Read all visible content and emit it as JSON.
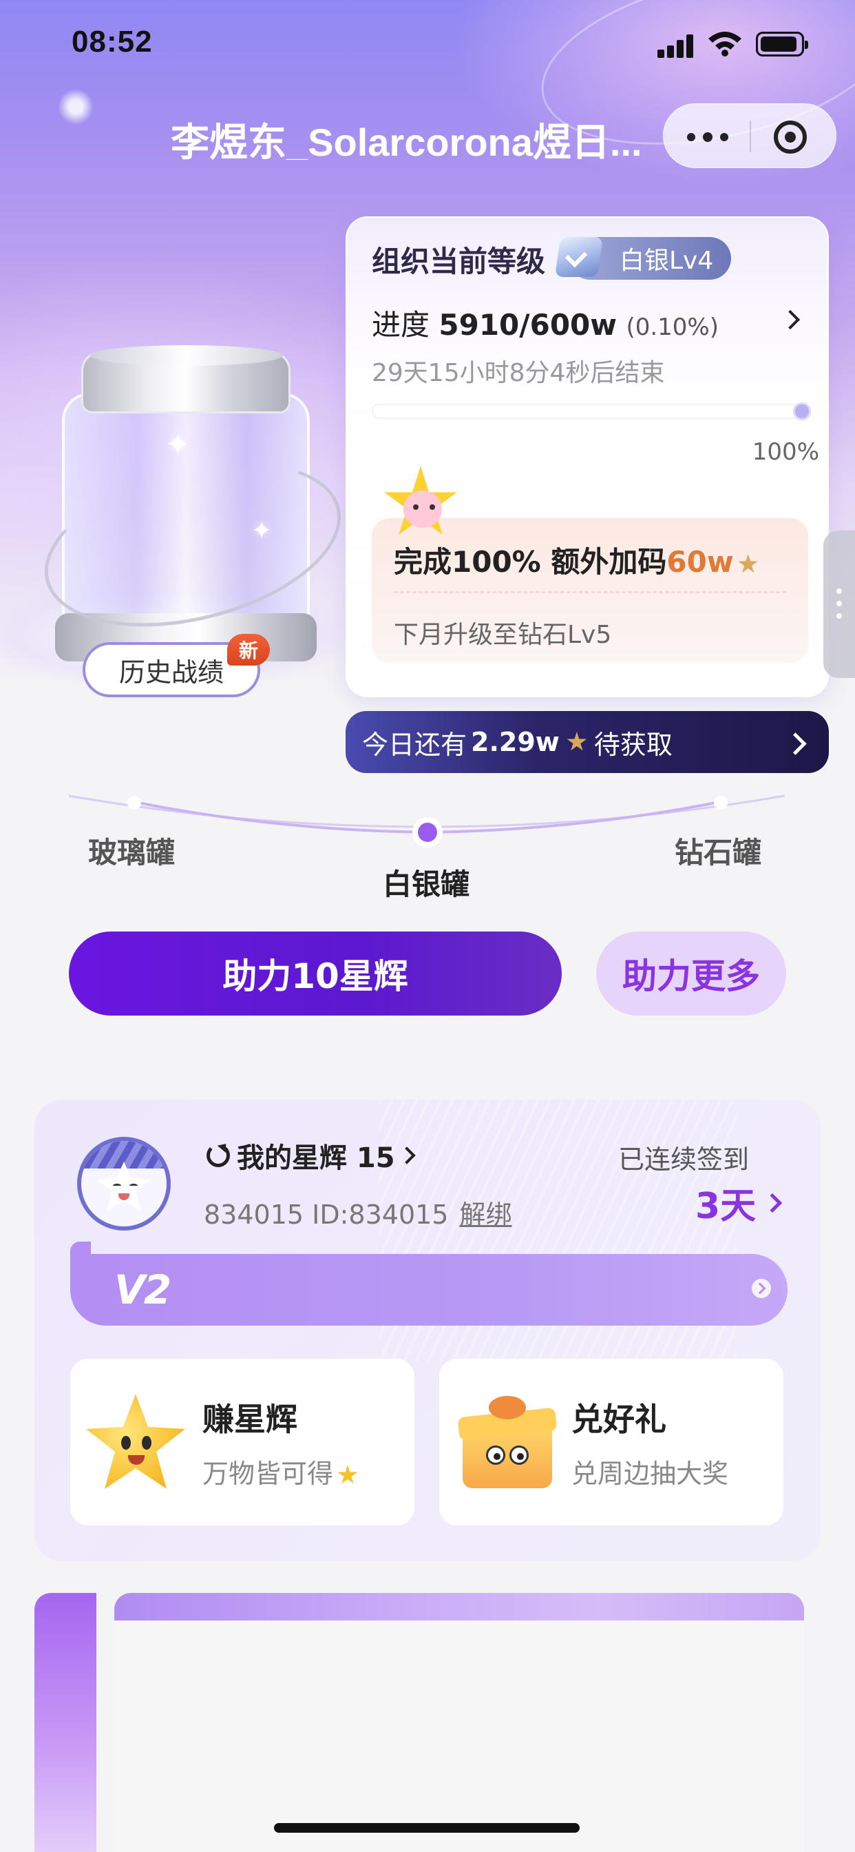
{
  "status_bar": {
    "time": "08:52"
  },
  "nav": {
    "title": "李煜东_Solarcorona煜日...",
    "more_icon": "more-dots-icon",
    "close_icon": "target-close-icon"
  },
  "jar": {
    "history_label": "历史战绩",
    "new_badge": "新"
  },
  "level_card": {
    "title": "组织当前等级",
    "badge": "白银Lv4",
    "progress_prefix": "进度",
    "progress_value": "5910/600w",
    "progress_percent": "(0.10%)",
    "countdown": "29天15小时8分4秒后结束",
    "bar_label": "100%",
    "bar_fraction": 1.0,
    "bonus_prefix": "完成100% 额外加码",
    "bonus_amount": "60w",
    "bonus_sub": "下月升级至钻石Lv5"
  },
  "today_banner": {
    "prefix": "今日还有",
    "amount": "2.29w",
    "suffix": "待获取"
  },
  "stages": {
    "items": [
      "玻璃罐",
      "白银罐",
      "钻石罐"
    ],
    "current_index": 1
  },
  "actions": {
    "boost_label": "助力10星辉",
    "boost_more_label": "助力更多"
  },
  "user": {
    "stars_label": "我的星辉 15",
    "id_text": "834015 ID:834015",
    "unbind_label": "解绑",
    "checkin_label": "已连续签到",
    "checkin_days": "3天",
    "vip_level": "V2"
  },
  "tiles": {
    "earn_title": "赚星辉",
    "earn_sub": "万物皆可得",
    "gift_title": "兑好礼",
    "gift_sub": "兑周边抽大奖"
  },
  "colors": {
    "primary_purple": "#6a16e0",
    "accent_purple": "#8a33e0",
    "bonus_orange": "#e07a35",
    "banner_dark": "#1d1747"
  }
}
